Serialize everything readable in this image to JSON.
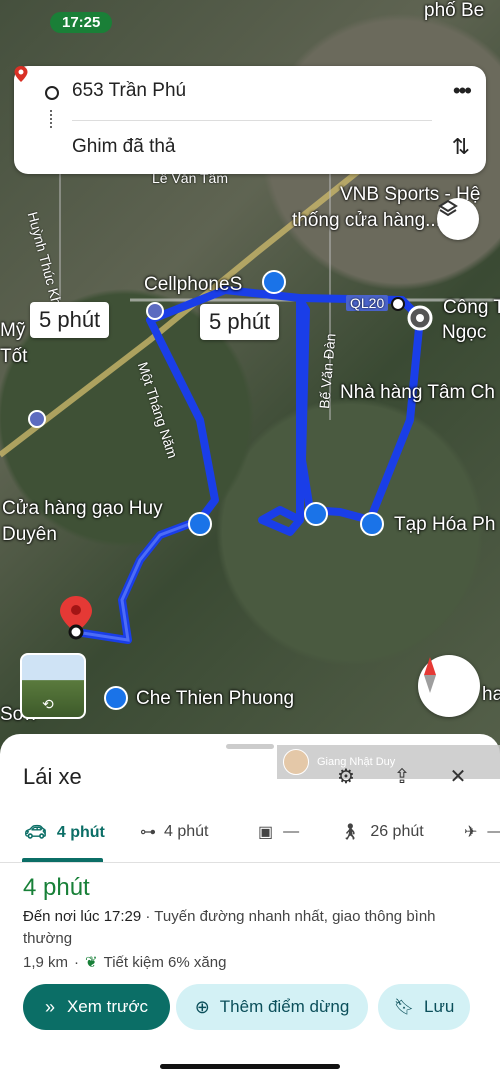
{
  "status": {
    "time": "17:25"
  },
  "route_card": {
    "origin": "653 Trần Phú",
    "destination": "Ghim đã thả"
  },
  "map": {
    "labels": {
      "top_right": "phố Be",
      "le_van_tam": "Lê Văn Tâm",
      "vnb_line1": "VNB Sports - Hệ",
      "vnb_line2": "thống cửa hàng...",
      "huynh": "Huỳnh Thúc Kháng",
      "cellphones": "CellphoneS",
      "ql20": "QL20",
      "cong_ty": "Công T",
      "ngoc": "Ngọc",
      "my": "Mỹ",
      "tot": "Tốt",
      "mot_thang_nam": "Một Tháng Năm",
      "be_van_dan": "Bế Văn Đàn",
      "nha_hang": "Nhà hàng Tâm Ch",
      "gao_line1": "Cửa hàng gạo Huy",
      "gao_line2": "Duyên",
      "tap_hoa": "Tạp Hóa Ph",
      "che": "Che Thien Phuong",
      "son": "Sơn",
      "ha": "ha"
    },
    "time_bubbles": [
      "5 phút",
      "5 phút"
    ],
    "route_color": "#1a3ee8"
  },
  "sheet": {
    "title": "Lái xe",
    "watermark": "Giang Nhật Duy",
    "tabs": [
      {
        "icon": "car-icon",
        "label": "4 phút"
      },
      {
        "icon": "motorbike-icon",
        "label": "4 phút"
      },
      {
        "icon": "transit-icon",
        "label": "—"
      },
      {
        "icon": "walk-icon",
        "label": "26 phút"
      },
      {
        "icon": "flight-icon",
        "label": "—"
      }
    ],
    "duration": "4 phút",
    "arrival_label": "Đến nơi lúc 17:29",
    "arrival_note": " · Tuyến đường nhanh nhất, giao thông bình thường",
    "distance": "1,9 km",
    "fuel_note": "Tiết kiệm 6% xăng",
    "buttons": {
      "preview": "Xem trước",
      "add_stop": "Thêm điểm dừng",
      "save": "Lưu"
    }
  },
  "colors": {
    "accent": "#0b6e66",
    "green_time": "#188038",
    "light_button": "#d3f1f5"
  }
}
